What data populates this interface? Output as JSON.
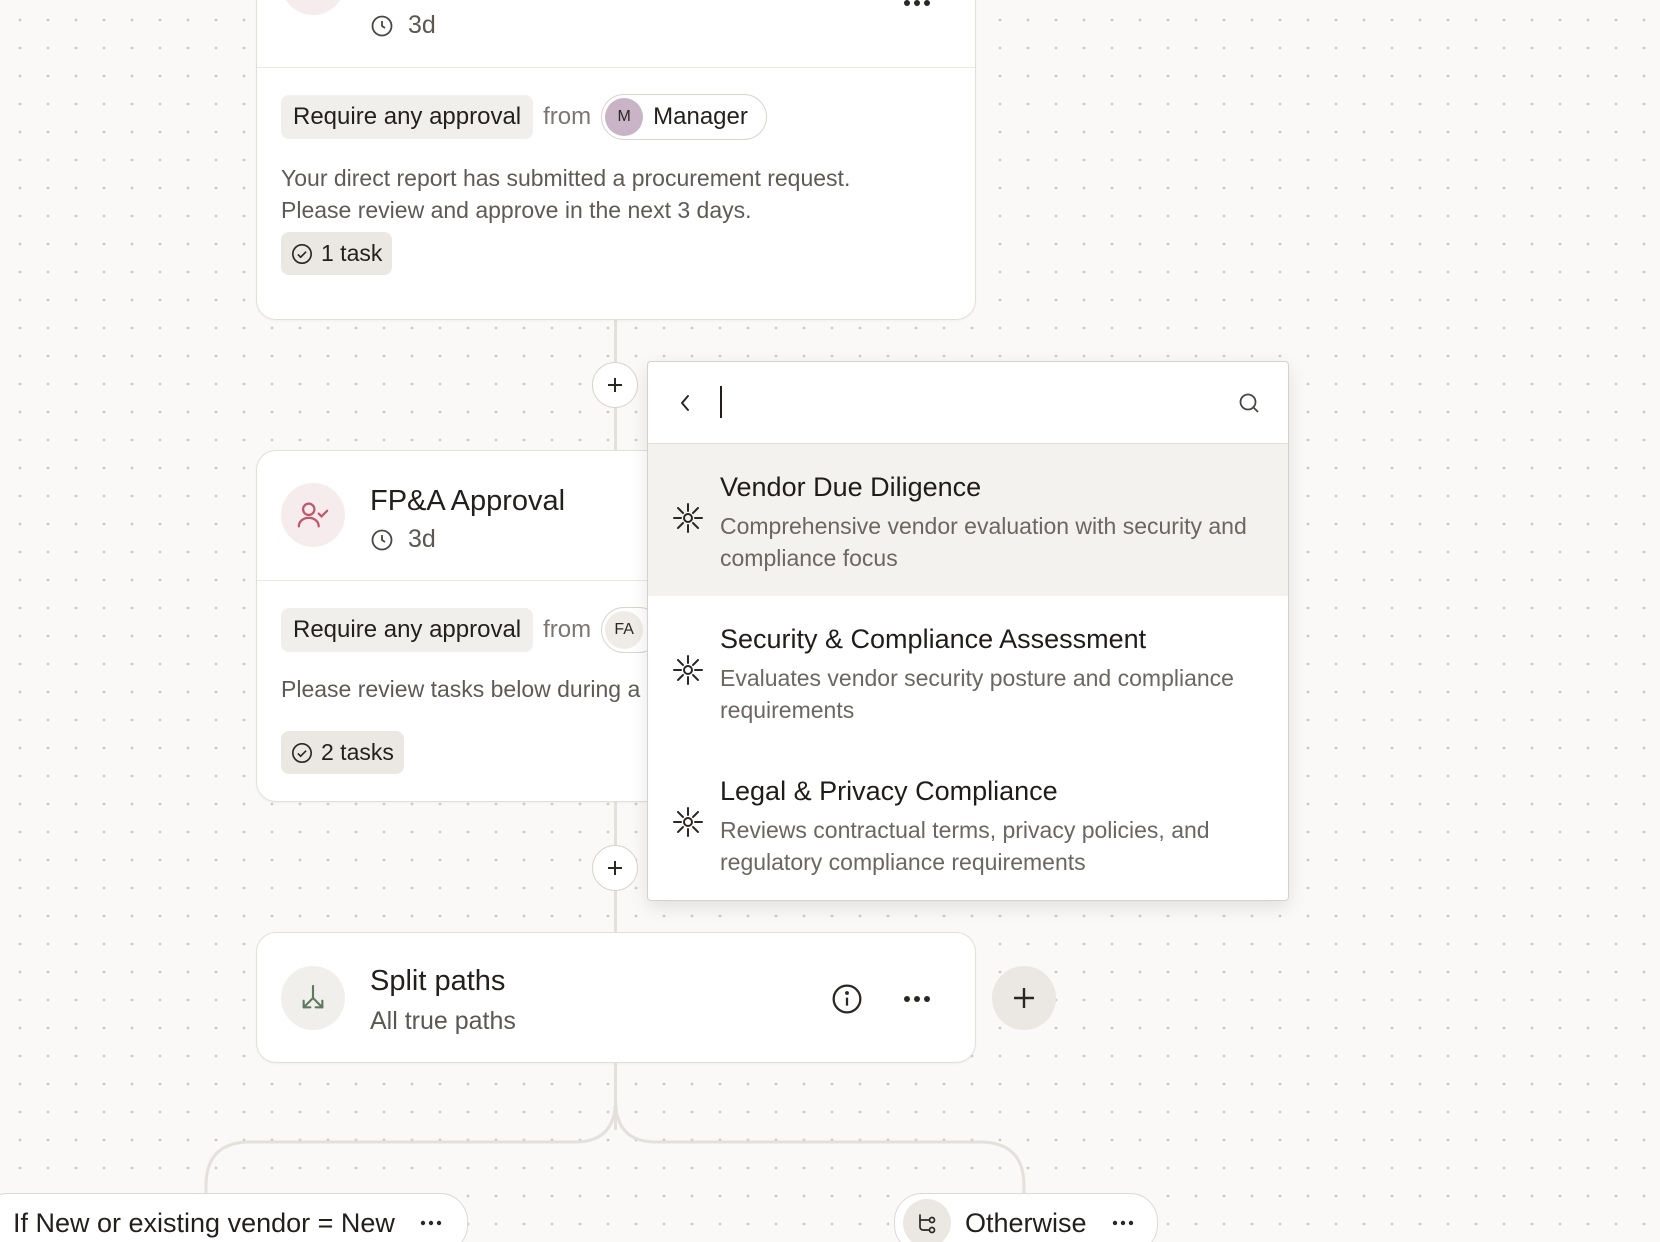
{
  "card_manager": {
    "duration": "3d",
    "requirement": "Require any approval",
    "from": "from",
    "approver_initial": "M",
    "approver_name": "Manager",
    "description_line1": "Your direct report has submitted a procurement request.",
    "description_line2": "Please review and approve in the next 3 days.",
    "tasks": "1 task"
  },
  "card_fpa": {
    "title": "FP&A Approval",
    "duration": "3d",
    "requirement": "Require any approval",
    "from": "from",
    "approver_initial": "FA",
    "description": "Please review tasks below during a",
    "tasks": "2 tasks"
  },
  "card_split": {
    "title": "Split paths",
    "subtitle": "All true paths"
  },
  "dropdown": {
    "search_value": "",
    "items": [
      {
        "title": "Vendor Due Diligence",
        "desc": "Comprehensive vendor evaluation with security and compliance focus"
      },
      {
        "title": "Security & Compliance Assessment",
        "desc": "Evaluates vendor security posture and compliance requirements"
      },
      {
        "title": "Legal & Privacy Compliance",
        "desc": "Reviews contractual terms, privacy policies, and regulatory compliance requirements"
      }
    ]
  },
  "paths": {
    "left_label": "If New or existing vendor = New",
    "right_label": "Otherwise"
  },
  "colors": {
    "accent_pink": "#c0576a",
    "accent_green": "#5f7a5f",
    "manager_badge": "#c9b3c6"
  }
}
